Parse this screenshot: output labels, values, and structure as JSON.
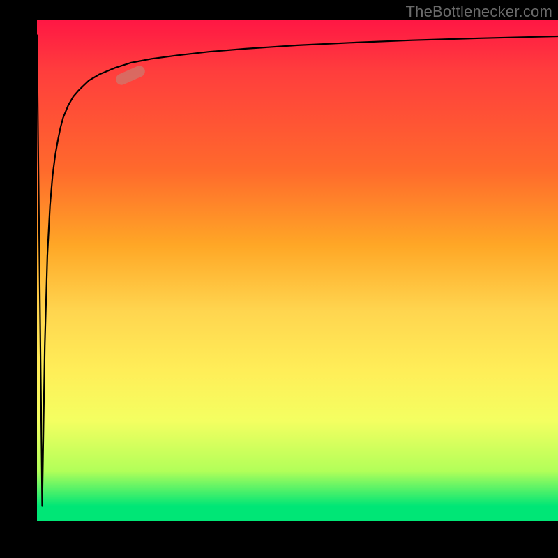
{
  "watermark": {
    "text": "TheBottlenecker.com"
  },
  "chart_data": {
    "type": "line",
    "title": "",
    "xlabel": "",
    "ylabel": "",
    "xlim": [
      0,
      100
    ],
    "ylim": [
      0,
      100
    ],
    "x": [
      0,
      0.5,
      1,
      1.5,
      2,
      2.5,
      3,
      3.5,
      4,
      4.5,
      5,
      6,
      7,
      8,
      9,
      10,
      12,
      15,
      18,
      22,
      27,
      33,
      40,
      50,
      60,
      72,
      85,
      100
    ],
    "y": [
      97,
      50,
      3,
      35,
      53,
      63,
      69,
      73,
      76,
      78.5,
      80.5,
      83,
      84.8,
      86,
      87,
      88,
      89.2,
      90.5,
      91.5,
      92.3,
      93,
      93.7,
      94.3,
      95,
      95.5,
      96,
      96.4,
      96.8
    ],
    "marker": {
      "x_percent": 18,
      "y_percent_from_top": 11,
      "rotation_deg": -24
    },
    "background_gradient": {
      "top": "#ff1744",
      "mid1": "#ffa726",
      "mid2": "#ffee58",
      "bottom": "#00e676"
    }
  }
}
